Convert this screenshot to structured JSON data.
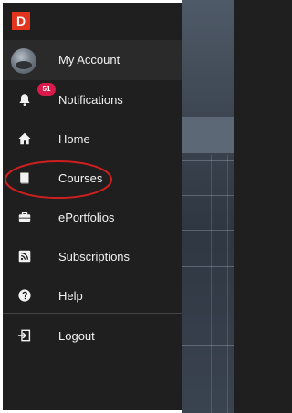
{
  "brand": {
    "letter": "D",
    "color": "#e3351e"
  },
  "sidebar": {
    "items": [
      {
        "label": "My Account",
        "icon": "avatar"
      },
      {
        "label": "Notifications",
        "icon": "bell-icon",
        "badge": "51"
      },
      {
        "label": "Home",
        "icon": "home-icon"
      },
      {
        "label": "Courses",
        "icon": "book-icon"
      },
      {
        "label": "ePortfolios",
        "icon": "briefcase-icon"
      },
      {
        "label": "Subscriptions",
        "icon": "rss-icon"
      },
      {
        "label": "Help",
        "icon": "help-icon"
      },
      {
        "label": "Logout",
        "icon": "logout-icon"
      }
    ]
  },
  "colors": {
    "sidebar_bg": "#1f1f1f",
    "account_row_bg": "#2a2a2a",
    "badge": "#d81b4b",
    "annotation": "#cc1f1f"
  }
}
